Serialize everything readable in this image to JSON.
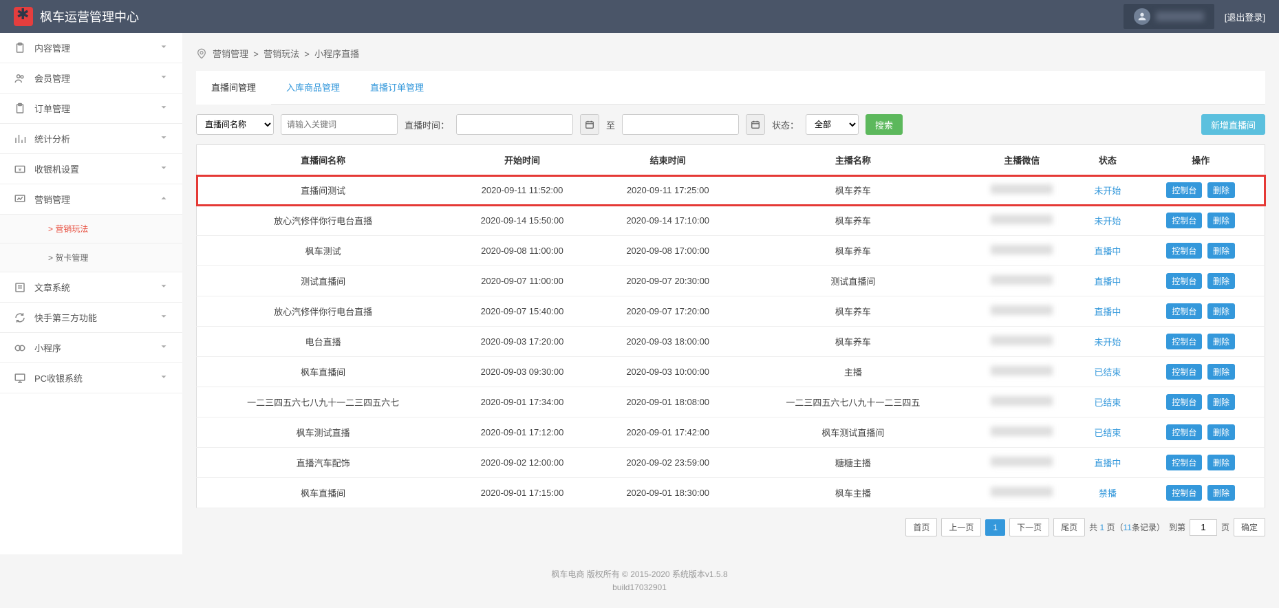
{
  "header": {
    "title": "枫车运营管理中心",
    "logout": "[退出登录]"
  },
  "sidebar": {
    "items": [
      {
        "label": "内容管理",
        "icon": "clipboard"
      },
      {
        "label": "会员管理",
        "icon": "users"
      },
      {
        "label": "订单管理",
        "icon": "clipboard"
      },
      {
        "label": "统计分析",
        "icon": "chart"
      },
      {
        "label": "收银机设置",
        "icon": "cash"
      },
      {
        "label": "营销管理",
        "icon": "monitor",
        "expanded": true,
        "children": [
          {
            "label": "> 营销玩法",
            "active": true
          },
          {
            "label": "> 贺卡管理"
          }
        ]
      },
      {
        "label": "文章系统",
        "icon": "article"
      },
      {
        "label": "快手第三方功能",
        "icon": "refresh"
      },
      {
        "label": "小程序",
        "icon": "mini"
      },
      {
        "label": "PC收银系统",
        "icon": "pc"
      }
    ]
  },
  "breadcrumb": [
    "营销管理",
    "营销玩法",
    "小程序直播"
  ],
  "tabs": [
    {
      "label": "直播间管理",
      "active": true
    },
    {
      "label": "入库商品管理"
    },
    {
      "label": "直播订单管理"
    }
  ],
  "filters": {
    "field_select": "直播间名称",
    "keyword_placeholder": "请输入关键词",
    "time_label": "直播时间：",
    "to_label": "至",
    "status_label": "状态：",
    "status_value": "全部",
    "search_btn": "搜索",
    "new_btn": "新增直播间"
  },
  "table": {
    "headers": [
      "直播间名称",
      "开始时间",
      "结束时间",
      "主播名称",
      "主播微信",
      "状态",
      "操作"
    ],
    "action_console": "控制台",
    "action_delete": "删除",
    "rows": [
      {
        "name": "直播间测试",
        "start": "2020-09-11 11:52:00",
        "end": "2020-09-11 17:25:00",
        "host": "枫车养车",
        "status": "未开始",
        "highlight": true
      },
      {
        "name": "放心汽修伴你行电台直播",
        "start": "2020-09-14 15:50:00",
        "end": "2020-09-14 17:10:00",
        "host": "枫车养车",
        "status": "未开始"
      },
      {
        "name": "枫车测试",
        "start": "2020-09-08 11:00:00",
        "end": "2020-09-08 17:00:00",
        "host": "枫车养车",
        "status": "直播中"
      },
      {
        "name": "测试直播间",
        "start": "2020-09-07 11:00:00",
        "end": "2020-09-07 20:30:00",
        "host": "测试直播间",
        "status": "直播中"
      },
      {
        "name": "放心汽修伴你行电台直播",
        "start": "2020-09-07 15:40:00",
        "end": "2020-09-07 17:20:00",
        "host": "枫车养车",
        "status": "直播中"
      },
      {
        "name": "电台直播",
        "start": "2020-09-03 17:20:00",
        "end": "2020-09-03 18:00:00",
        "host": "枫车养车",
        "status": "未开始"
      },
      {
        "name": "枫车直播间",
        "start": "2020-09-03 09:30:00",
        "end": "2020-09-03 10:00:00",
        "host": "主播",
        "status": "已结束"
      },
      {
        "name": "一二三四五六七八九十一二三四五六七",
        "start": "2020-09-01 17:34:00",
        "end": "2020-09-01 18:08:00",
        "host": "一二三四五六七八九十一二三四五",
        "status": "已结束"
      },
      {
        "name": "枫车测试直播",
        "start": "2020-09-01 17:12:00",
        "end": "2020-09-01 17:42:00",
        "host": "枫车测试直播间",
        "status": "已结束"
      },
      {
        "name": "直播汽车配饰",
        "start": "2020-09-02 12:00:00",
        "end": "2020-09-02 23:59:00",
        "host": "糖糖主播",
        "status": "直播中"
      },
      {
        "name": "枫车直播间",
        "start": "2020-09-01 17:15:00",
        "end": "2020-09-01 18:30:00",
        "host": "枫车主播",
        "status": "禁播"
      }
    ]
  },
  "pagination": {
    "first": "首页",
    "prev": "上一页",
    "current": "1",
    "next": "下一页",
    "last": "尾页",
    "total_prefix": "共 ",
    "total_pages": "1",
    "total_mid": " 页（",
    "total_records": "11",
    "total_suffix": "条记录）",
    "goto_prefix": "到第",
    "goto_value": "1",
    "goto_suffix": "页",
    "confirm": "确定"
  },
  "footer": {
    "line1": "枫车电商 版权所有 © 2015-2020 系统版本v1.5.8",
    "line2": "build17032901"
  }
}
